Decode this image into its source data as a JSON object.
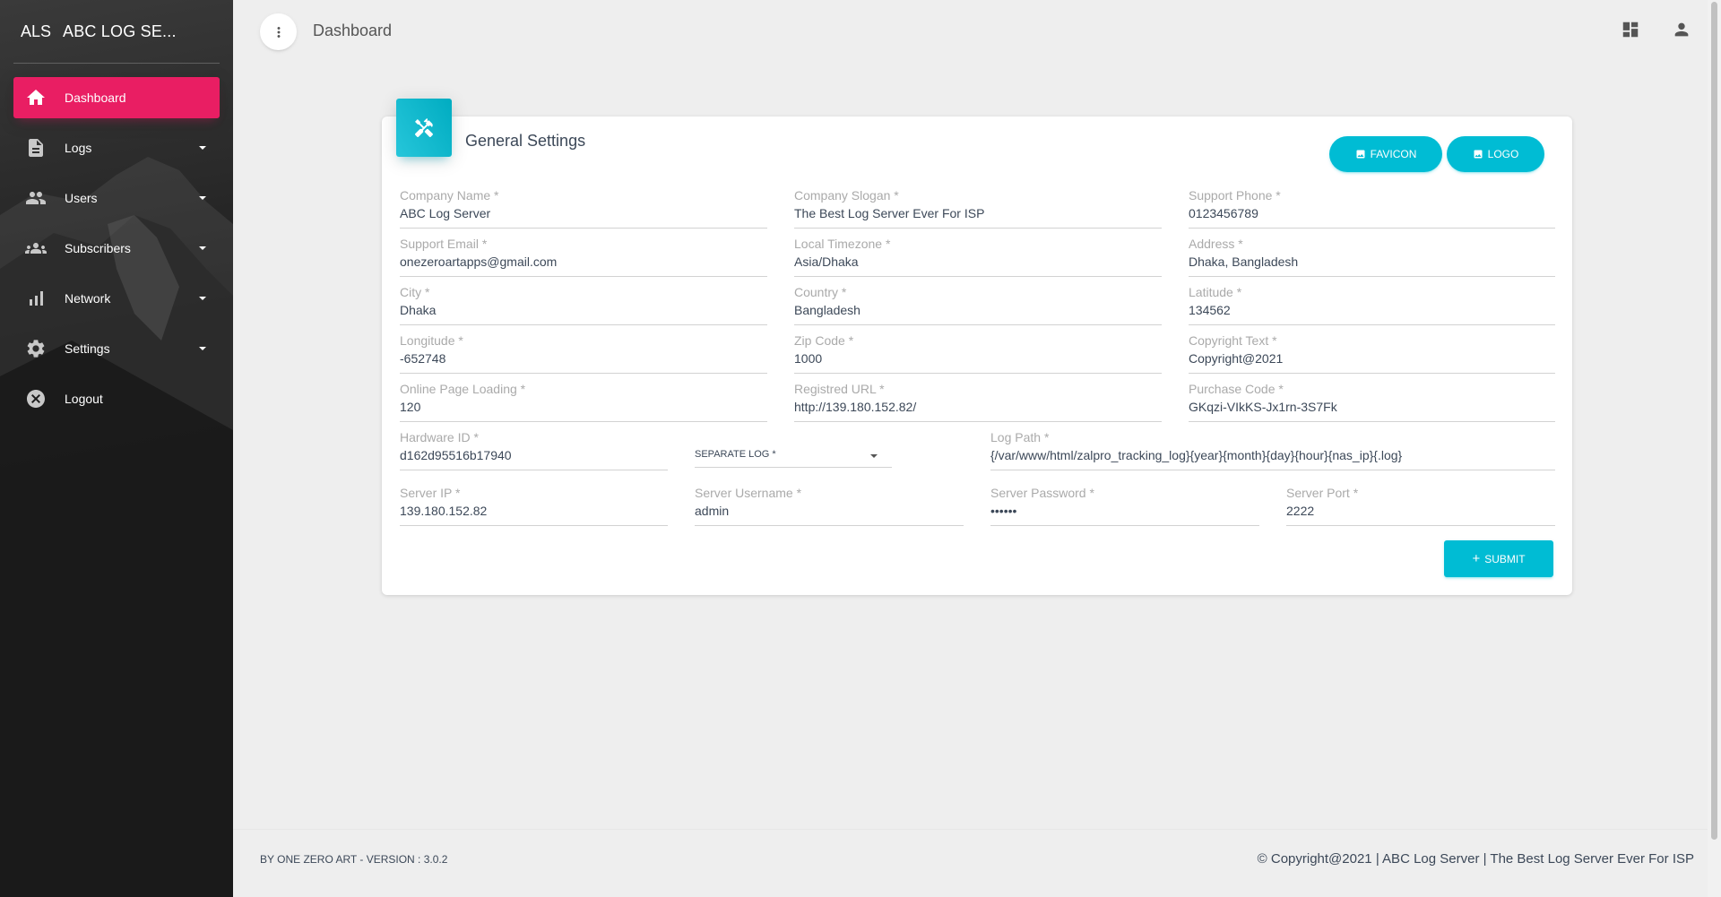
{
  "brand": {
    "mini": "ALS",
    "full": "ABC LOG SE..."
  },
  "sidebar": {
    "items": [
      {
        "label": "Dashboard",
        "icon": "home-icon",
        "active": true,
        "expandable": false
      },
      {
        "label": "Logs",
        "icon": "document-icon",
        "active": false,
        "expandable": true
      },
      {
        "label": "Users",
        "icon": "people-icon",
        "active": false,
        "expandable": true
      },
      {
        "label": "Subscribers",
        "icon": "group-icon",
        "active": false,
        "expandable": true
      },
      {
        "label": "Network",
        "icon": "bar-chart-icon",
        "active": false,
        "expandable": true
      },
      {
        "label": "Settings",
        "icon": "gear-icon",
        "active": false,
        "expandable": true
      },
      {
        "label": "Logout",
        "icon": "close-circle-icon",
        "active": false,
        "expandable": false
      }
    ],
    "active_color": "#e91e63"
  },
  "header": {
    "title": "Dashboard"
  },
  "card": {
    "title": "General Settings",
    "favicon_label": "FAVICON",
    "logo_label": "LOGO",
    "submit_label": "SUBMIT",
    "accent": "#00bcd4"
  },
  "fields": {
    "company_name": {
      "label": "Company Name *",
      "value": "ABC Log Server"
    },
    "company_slogan": {
      "label": "Company Slogan *",
      "value": "The Best Log Server Ever For ISP"
    },
    "support_phone": {
      "label": "Support Phone *",
      "value": "0123456789"
    },
    "support_email": {
      "label": "Support Email *",
      "value": "onezeroartapps@gmail.com"
    },
    "local_timezone": {
      "label": "Local Timezone *",
      "value": "Asia/Dhaka"
    },
    "address": {
      "label": "Address *",
      "value": "Dhaka, Bangladesh"
    },
    "city": {
      "label": "City *",
      "value": "Dhaka"
    },
    "country": {
      "label": "Country *",
      "value": "Bangladesh"
    },
    "latitude": {
      "label": "Latitude *",
      "value": "134562"
    },
    "longitude": {
      "label": "Longitude *",
      "value": "-652748"
    },
    "zip_code": {
      "label": "Zip Code *",
      "value": "1000"
    },
    "copyright_text": {
      "label": "Copyright Text *",
      "value": "Copyright@2021"
    },
    "online_page_loading": {
      "label": "Online Page Loading *",
      "value": "120"
    },
    "registred_url": {
      "label": "Registred URL *",
      "value": "http://139.180.152.82/"
    },
    "purchase_code": {
      "label": "Purchase Code *",
      "value": "GKqzi-VIkKS-Jx1rn-3S7Fk"
    },
    "hardware_id": {
      "label": "Hardware ID *",
      "value": "d162d95516b17940"
    },
    "separate_log": {
      "label": "SEPARATE LOG *"
    },
    "log_path": {
      "label": "Log Path *",
      "value": "{/var/www/html/zalpro_tracking_log}{year}{month}{day}{hour}{nas_ip}{.log}"
    },
    "server_ip": {
      "label": "Server IP *",
      "value": "139.180.152.82"
    },
    "server_username": {
      "label": "Server Username *",
      "value": "admin"
    },
    "server_password": {
      "label": "Server Password *",
      "value": "••••••"
    },
    "server_port": {
      "label": "Server Port *",
      "value": "2222"
    }
  },
  "footer": {
    "left": "BY ONE ZERO ART - VERSION : 3.0.2",
    "right": "© Copyright@2021 | ABC Log Server | The Best Log Server Ever For ISP"
  }
}
